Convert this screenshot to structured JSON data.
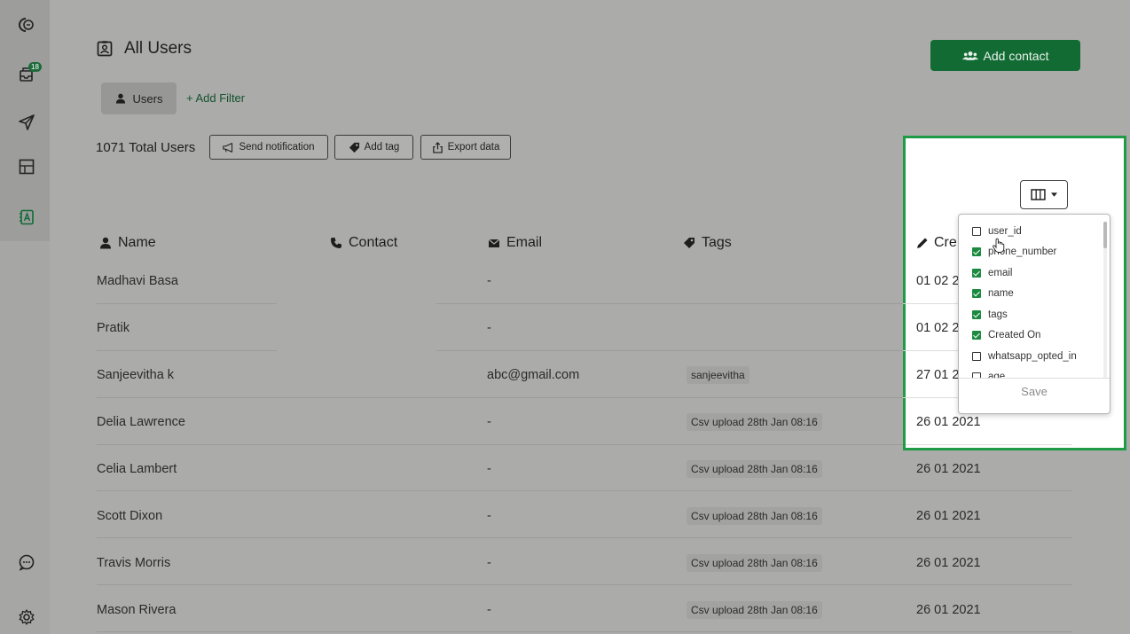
{
  "sidebar": {
    "items": [
      {
        "icon": "logo-icon"
      },
      {
        "icon": "inbox-icon",
        "badge": "18"
      },
      {
        "icon": "send-icon"
      },
      {
        "icon": "layout-icon"
      },
      {
        "icon": "contacts-icon"
      },
      {
        "icon": "chat-icon"
      },
      {
        "icon": "settings-icon"
      }
    ]
  },
  "header": {
    "title": "All Users",
    "add_contact_label": "Add contact",
    "filter_chip": "Users",
    "add_filter": "+ Add Filter",
    "total_users": "1071 Total Users",
    "actions": {
      "send_notification": "Send notification",
      "add_tag": "Add tag",
      "export_data": "Export data"
    }
  },
  "table": {
    "columns": {
      "name": "Name",
      "contact": "Contact",
      "email": "Email",
      "tags": "Tags",
      "created": "Cre"
    },
    "rows": [
      {
        "name": "Madhavi Basa",
        "email": "-",
        "tag": "",
        "created": "01 02 2"
      },
      {
        "name": "Pratik",
        "email": "-",
        "tag": "",
        "created": "01 02 2"
      },
      {
        "name": "Sanjeevitha k",
        "email": "abc@gmail.com",
        "tag": "sanjeevitha",
        "created": "27 01 2"
      },
      {
        "name": "Delia Lawrence",
        "email": "-",
        "tag": "Csv upload 28th Jan 08:16",
        "created": "26 01 2021"
      },
      {
        "name": "Celia Lambert",
        "email": "-",
        "tag": "Csv upload 28th Jan 08:16",
        "created": "26 01 2021"
      },
      {
        "name": "Scott Dixon",
        "email": "-",
        "tag": "Csv upload 28th Jan 08:16",
        "created": "26 01 2021"
      },
      {
        "name": "Travis Morris",
        "email": "-",
        "tag": "Csv upload 28th Jan 08:16",
        "created": "26 01 2021"
      },
      {
        "name": "Mason Rivera",
        "email": "-",
        "tag": "Csv upload 28th Jan 08:16",
        "created": "26 01 2021"
      }
    ]
  },
  "column_picker": {
    "options": [
      {
        "label": "user_id",
        "checked": false
      },
      {
        "label": "phone_number",
        "checked": true
      },
      {
        "label": "email",
        "checked": true
      },
      {
        "label": "name",
        "checked": true
      },
      {
        "label": "tags",
        "checked": true
      },
      {
        "label": "Created On",
        "checked": true
      },
      {
        "label": "whatsapp_opted_in",
        "checked": false
      },
      {
        "label": "age",
        "checked": false
      }
    ],
    "save_label": "Save"
  },
  "colors": {
    "accent": "#136b34",
    "highlight": "#1e9b44",
    "checkbox": "#1a8a3f"
  }
}
